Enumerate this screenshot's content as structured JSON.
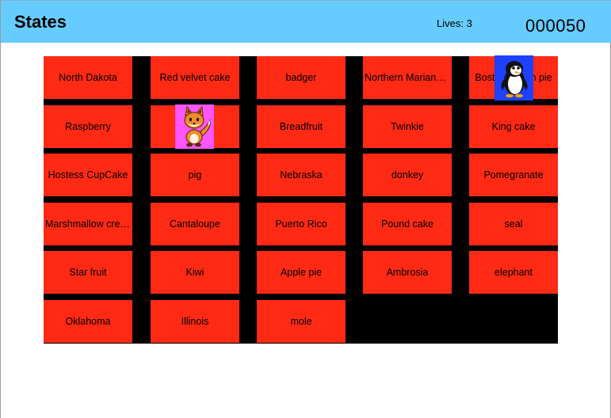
{
  "header": {
    "title": "States",
    "lives_text": "Lives: 3",
    "score": "000050",
    "background_color": "#66ccff"
  },
  "board": {
    "cell_color": "#ff2a14",
    "background_color": "#000000",
    "rows": [
      [
        "North Dakota",
        "Red velvet cake",
        "badger",
        "Northern Mariana Islands",
        "Boston cream pie"
      ],
      [
        "Raspberry",
        "",
        "Breadfruit",
        "Twinkie",
        "King cake"
      ],
      [
        "Hostess CupCake",
        "pig",
        "Nebraska",
        "donkey",
        "Pomegranate"
      ],
      [
        "Marshmallow creme",
        "Cantaloupe",
        "Puerto Rico",
        "Pound cake",
        "seal"
      ],
      [
        "Star fruit",
        "Kiwi",
        "Apple pie",
        "Ambrosia",
        "elephant"
      ],
      [
        "Oklahoma",
        "Illinois",
        "mole"
      ]
    ]
  },
  "sprites": {
    "player": {
      "name": "fox",
      "background_color": "#ff55ff"
    },
    "enemy": {
      "name": "penguin",
      "background_color": "#1e40ff"
    }
  }
}
